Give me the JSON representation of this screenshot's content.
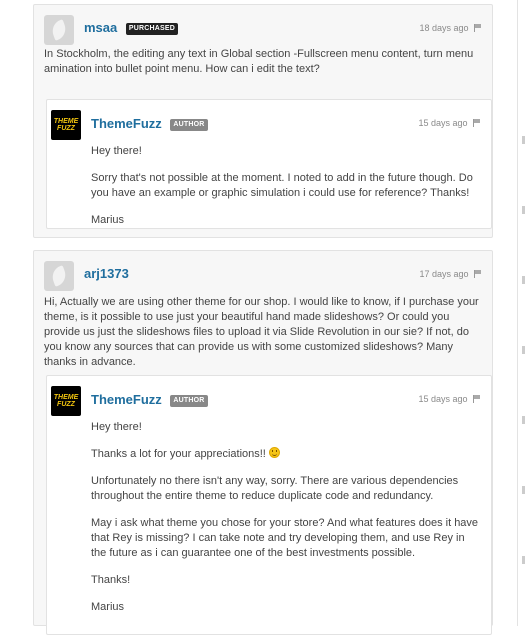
{
  "comments": [
    {
      "username": "msaa",
      "badge": "PURCHASED",
      "time": "18 days ago",
      "paragraphs": [
        "In Stockholm, the editing any text in Global section -Fullscreen menu content, turn menu amination into bullet point menu. How can i edit the text?"
      ],
      "reply": {
        "username": "ThemeFuzz",
        "badge": "AUTHOR",
        "time": "15 days ago",
        "paragraphs": [
          "Hey there!",
          "Sorry that's not possible at the moment. I noted to add in the future though. Do you have an example or graphic simulation i could use for reference? Thanks!",
          "Marius"
        ]
      }
    },
    {
      "username": "arj1373",
      "badge": "",
      "time": "17 days ago",
      "paragraphs": [
        "Hi, Actually we are using other theme for our shop. I would like to know, if I purchase your theme, is it possible to use just your beautiful hand made slideshows? Or could you provide us just the slideshows files to upload it via Slide Revolution in our sie? If not, do you know any sources that can provide us with some customized slideshows? Many thanks in advance."
      ],
      "reply": {
        "username": "ThemeFuzz",
        "badge": "AUTHOR",
        "time": "15 days ago",
        "paragraphs": [
          "Hey there!",
          "Thanks a lot for your appreciations!!",
          "Unfortunately no there isn't any way, sorry. There are various dependencies throughout the entire theme to reduce duplicate code and redundancy.",
          "May i ask what theme you chose for your store? And what features does it have that Rey is missing? I can take note and try developing them, and use Rey in the future as i can guarantee one of the best investments possible.",
          "Thanks!",
          "Marius"
        ]
      }
    }
  ],
  "avatar_logo_text": [
    "THEME",
    "FUZZ"
  ]
}
